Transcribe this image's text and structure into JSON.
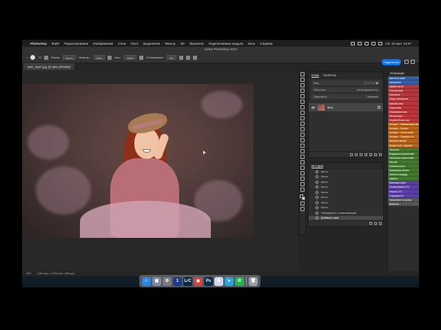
{
  "menubar": {
    "app": "Photoshop",
    "items": [
      "Файл",
      "Редактирование",
      "Изображение",
      "Слои",
      "Текст",
      "Выделение",
      "Фильтр",
      "3D",
      "Просмотр",
      "Подключаемые модули",
      "Окно",
      "Справка"
    ],
    "clock": "Сб, 10 июл. 13:37"
  },
  "options": {
    "window_title": "Adobe Photoshop 2022",
    "brush_size": "70",
    "mode_label": "Режим:",
    "mode_value": "Кисть",
    "opacity_label": "Непрозр.:",
    "opacity_value": "46%",
    "flow_label": "Наж.:",
    "flow_value": "100%",
    "smoothing_label": "Сглаживание:",
    "smoothing_value": "0%",
    "share_label": "Поделиться"
  },
  "document": {
    "tab_title": "IMG_2947.jpg @ 59% (RGB/8)",
    "status_zoom": "59%",
    "status_info": "3180 пикс. x 2790 пикс. (300 ppi)"
  },
  "layers_panel": {
    "tab_layers": "Слои",
    "tab_properties": "Свойства",
    "filter_label": "Вид",
    "blend_mode": "Обычные",
    "opacity_label": "Непрозрачность:",
    "lock_label": "Закрепить:",
    "fill_label": "Заливка:",
    "layer_name": "Фон"
  },
  "history_panel": {
    "title": "История",
    "items": [
      "Кисть",
      "Кисть",
      "Кисть",
      "Кисть",
      "Кисть",
      "Кисть",
      "Кисть",
      "Кисть",
      "Объединить с нижележащим",
      "Добавить шум"
    ]
  },
  "actions_panel": {
    "title": "Операции",
    "items": [
      {
        "label": "цветность кожи",
        "color": "blue"
      },
      {
        "label": "портретная",
        "color": "blue"
      },
      {
        "label": "эффект фона",
        "color": "red"
      },
      {
        "label": "Оттенок кожи",
        "color": "red"
      },
      {
        "label": "Осветлить",
        "color": "red"
      },
      {
        "label": "Загар, затемнение",
        "color": "red"
      },
      {
        "label": "Красная кожа",
        "color": "red"
      },
      {
        "label": "Серая кожа",
        "color": "red"
      },
      {
        "label": "Персиковая кожа",
        "color": "red"
      },
      {
        "label": "Желтая кожа",
        "color": "red"
      },
      {
        "label": "Голубые белки глаз",
        "color": "red"
      },
      {
        "label": "Контраст - Минимизация мелких",
        "color": "orange"
      },
      {
        "label": "Контраст - Кремен",
        "color": "orange"
      },
      {
        "label": "Контраст - Синий канал",
        "color": "orange"
      },
      {
        "label": "Контраст - Радиирастон",
        "color": "orange"
      },
      {
        "label": "Контраст мягкий",
        "color": "orange"
      },
      {
        "label": "Новый слой - оверлей",
        "color": "orange"
      },
      {
        "label": "Свечение",
        "color": "green"
      },
      {
        "label": "Воздушная перспектива",
        "color": "green"
      },
      {
        "label": "Тональная перспектива",
        "color": "green"
      },
      {
        "label": "Теплый",
        "color": "green"
      },
      {
        "label": "Осветлить фон",
        "color": "green"
      },
      {
        "label": "Приглушить зелень",
        "color": "green"
      },
      {
        "label": "Зелень в изумруд",
        "color": "green"
      },
      {
        "label": "Удалить",
        "color": "green"
      },
      {
        "label": "Имитация шума",
        "color": "violet"
      },
      {
        "label": "Четкая резкость 2.0",
        "color": "violet"
      },
      {
        "label": "Резкость 5.0",
        "color": "violet"
      },
      {
        "label": "Структура 5.0",
        "color": "violet"
      },
      {
        "label": "Заполнение по краям",
        "color": "gray"
      },
      {
        "label": "Виньетка",
        "color": "gray"
      }
    ]
  },
  "dock": {
    "icons": [
      {
        "name": "finder-icon",
        "glyph": "☺",
        "color": "#2e86de"
      },
      {
        "name": "launchpad-icon",
        "glyph": "▦",
        "color": "#7d8da1"
      },
      {
        "name": "settings-icon",
        "glyph": "⚙",
        "color": "#7b7b7b"
      },
      {
        "name": "one-password-icon",
        "glyph": "1",
        "color": "#1f3c88"
      },
      {
        "name": "lightroom-classic-icon",
        "glyph": "LrC",
        "color": "#0c2744"
      },
      {
        "name": "chrome-icon",
        "glyph": "◉",
        "color": "#d8423a"
      },
      {
        "name": "photoshop-icon",
        "glyph": "Ps",
        "color": "#0b2a4a"
      },
      {
        "name": "preview-icon",
        "glyph": "❀",
        "color": "#cfd8e8"
      },
      {
        "name": "telegram-icon",
        "glyph": "➤",
        "color": "#2aa1da"
      },
      {
        "name": "whatsapp-icon",
        "glyph": "✆",
        "color": "#26b44a"
      },
      {
        "name": "trash-icon",
        "glyph": "🗑",
        "color": "#9aa0a6"
      }
    ]
  },
  "colors": {
    "share": "#1473e6",
    "actions_blue": "#2f5fa8",
    "actions_red": "#b8363b",
    "actions_orange": "#b86217",
    "actions_green": "#3f7a2c",
    "actions_violet": "#5b3da6",
    "actions_gray": "#555555"
  }
}
